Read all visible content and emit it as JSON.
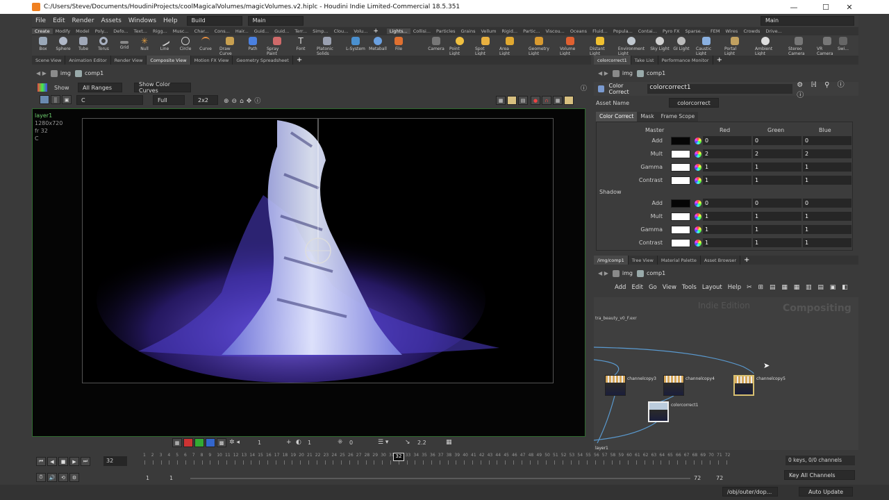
{
  "window": {
    "title": "C:/Users/Steve/Documents/HoudiniProjects/coolMagicalVolumes/magicVolumes.v2.hiplc - Houdini Indie Limited-Commercial 18.5.351",
    "minimize": "—",
    "maximize": "☐",
    "close": "✕"
  },
  "menu": {
    "items": [
      "File",
      "Edit",
      "Render",
      "Assets",
      "Windows",
      "Help"
    ],
    "build": "Build",
    "desktop": "Main",
    "right_desktop": "Main"
  },
  "shelf_tabs_left": [
    "Create",
    "Modify",
    "Model",
    "Poly...",
    "Defo...",
    "Text...",
    "Rigg...",
    "Musc...",
    "Char...",
    "Cons...",
    "Hair...",
    "Guid...",
    "Guid...",
    "Terr...",
    "Simp...",
    "Clou...",
    "Volu..."
  ],
  "shelf_tabs_right": [
    "Lights...",
    "Collisi...",
    "Particles",
    "Grains",
    "Vellum",
    "Rigid...",
    "Partic...",
    "Viscou...",
    "Oceans",
    "Fluid...",
    "Popula...",
    "Contai...",
    "Pyro FX",
    "Sparse...",
    "FEM",
    "Wires",
    "Crowds",
    "Drive..."
  ],
  "tools_left": [
    "Box",
    "Sphere",
    "Tube",
    "Torus",
    "Grid",
    "Null",
    "Line",
    "Circle",
    "Curve",
    "Draw Curve",
    "Path",
    "Spray Paint",
    "Font",
    "Platonic Solids",
    "L-System",
    "Metaball",
    "File"
  ],
  "tools_right": [
    "Camera",
    "Point Light",
    "Spot Light",
    "Area Light",
    "Geometry Light",
    "Volume Light",
    "Distant Light",
    "Environment Light",
    "Sky Light",
    "GI Light",
    "Caustic Light",
    "Portal Light",
    "Ambient Light",
    "Stereo Camera",
    "VR Camera",
    "Swi..."
  ],
  "pane_tabs_left": [
    "Scene View",
    "Animation Editor",
    "Render View",
    "Composite View",
    "Motion FX View",
    "Geometry Spreadsheet"
  ],
  "pane_tabs_right": [
    "colorcorrect1",
    "Take List",
    "Performance Monitor"
  ],
  "left_path": {
    "network": "img",
    "node": "comp1"
  },
  "viewer_toolbar": {
    "show": "Show",
    "ranges": "All Ranges",
    "color_curves": "Show Color Curves",
    "plane": "C",
    "res": "Full",
    "tile": "2x2"
  },
  "overlay": {
    "layer": "layer1",
    "res": "1280x720",
    "frame": "fr 32",
    "plane": "C"
  },
  "bottom_toolbar": {
    "v1": "1",
    "v2": "1",
    "v3": "0",
    "gamma": "2.2"
  },
  "parm_header": {
    "type": "Color Correct",
    "name": "colorcorrect1",
    "asset_name_label": "Asset Name",
    "asset_name": "colorcorrect"
  },
  "parm_tabs": [
    "Color Correct",
    "Mask",
    "Frame Scope"
  ],
  "parm_cols": {
    "master": "Master",
    "red": "Red",
    "green": "Green",
    "blue": "Blue"
  },
  "master_rows": [
    {
      "label": "Add",
      "swatch": "#050505",
      "r": "0",
      "g": "0",
      "b": "0"
    },
    {
      "label": "Mult",
      "swatch": "#ffffff",
      "r": "2",
      "g": "2",
      "b": "2"
    },
    {
      "label": "Gamma",
      "swatch": "#ffffff",
      "r": "1",
      "g": "1",
      "b": "1"
    },
    {
      "label": "Contrast",
      "swatch": "#ffffff",
      "r": "1",
      "g": "1",
      "b": "1"
    }
  ],
  "shadow_label": "Shadow",
  "shadow_rows": [
    {
      "label": "Add",
      "swatch": "#050505",
      "r": "0",
      "g": "0",
      "b": "0"
    },
    {
      "label": "Mult",
      "swatch": "#ffffff",
      "r": "1",
      "g": "1",
      "b": "1"
    },
    {
      "label": "Gamma",
      "swatch": "#ffffff",
      "r": "1",
      "g": "1",
      "b": "1"
    },
    {
      "label": "Contrast",
      "swatch": "#ffffff",
      "r": "1",
      "g": "1",
      "b": "1"
    }
  ],
  "net_tabs": [
    "/img/comp1",
    "Tree View",
    "Material Palette",
    "Asset Browser"
  ],
  "net_path": {
    "network": "img",
    "node": "comp1"
  },
  "net_menu": [
    "Add",
    "Edit",
    "Go",
    "View",
    "Tools",
    "Layout",
    "Help"
  ],
  "net_watermarks": {
    "edition": "Indie Edition",
    "context": "Compositing"
  },
  "net_nodes": {
    "file": "tra_beauty_v0_F.exr",
    "n1": "channelcopy3",
    "n2": "channelcopy4",
    "n3": "channelcopy5",
    "n4": "colorcorrect1",
    "layer": "layer1"
  },
  "timeline": {
    "frame": "32",
    "current_marker": "32",
    "start": "1",
    "start2": "1",
    "end": "72",
    "end2": "72",
    "ticks": [
      "1",
      "2",
      "3",
      "4",
      "5",
      "6",
      "7",
      "8",
      "9",
      "10",
      "11",
      "12",
      "13",
      "14",
      "15",
      "16",
      "17",
      "18",
      "19",
      "20",
      "21",
      "22",
      "23",
      "24",
      "25",
      "26",
      "27",
      "28",
      "29",
      "30",
      "31",
      "32",
      "33",
      "34",
      "35",
      "36",
      "37",
      "38",
      "39",
      "40",
      "41",
      "42",
      "43",
      "44",
      "45",
      "46",
      "47",
      "48",
      "49",
      "50",
      "51",
      "52",
      "53",
      "54",
      "55",
      "56",
      "57",
      "58",
      "59",
      "60",
      "61",
      "62",
      "63",
      "64",
      "65",
      "66",
      "67",
      "68",
      "69",
      "70",
      "71",
      "72"
    ],
    "keys": "0 keys, 0/0 channels",
    "key_all": "Key All Channels"
  },
  "status": {
    "path": "/obj/outer/dop...",
    "update": "Auto Update"
  },
  "colors": {
    "accent": "#f08020",
    "viewer_border": "#2e6a2e",
    "flame_purple": "#6a4cff",
    "flame_white": "#dfe6ff"
  }
}
